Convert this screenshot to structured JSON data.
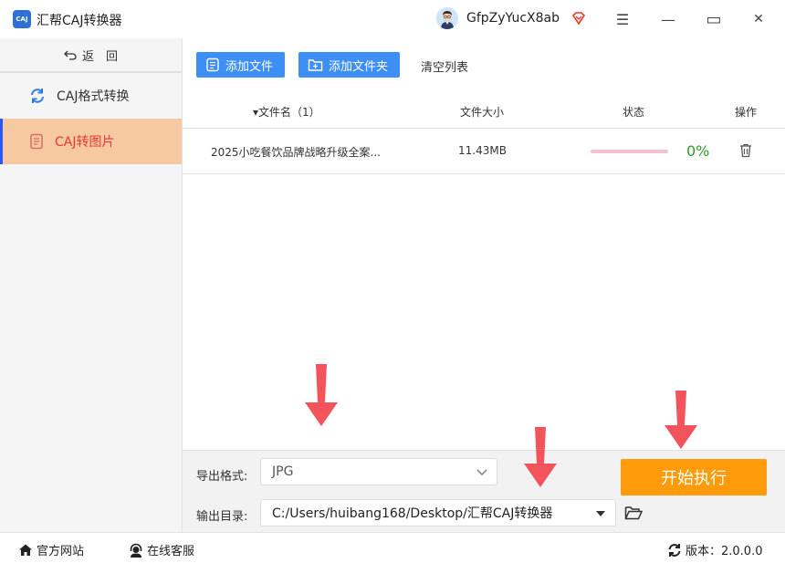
{
  "titlebar": {
    "logo_text": "CAJ",
    "app_title": "汇帮CAJ转换器",
    "user_name": "GfpZyYucX8ab",
    "menu_glyph": "☰",
    "minimize_glyph": "—",
    "maximize_glyph": "▭",
    "close_glyph": "✕"
  },
  "sidebar": {
    "back_label": "返　回",
    "items": [
      {
        "label": "CAJ格式转换",
        "icon": "refresh-icon"
      },
      {
        "label": "CAJ转图片",
        "icon": "document-icon",
        "active": true
      }
    ]
  },
  "toolbar": {
    "add_file_label": "添加文件",
    "add_folder_label": "添加文件夹",
    "clear_list_label": "清空列表"
  },
  "table": {
    "headers": {
      "filename": "▾文件名（1）",
      "filesize": "文件大小",
      "status": "状态",
      "actions": "操作"
    },
    "rows": [
      {
        "filename": "2025小吃餐饮品牌战略升级全案...",
        "filesize": "11.43MB",
        "progress": 0,
        "progress_text": "0%"
      }
    ]
  },
  "settings": {
    "format_label": "导出格式:",
    "format_value": "JPG",
    "output_label": "输出目录:",
    "output_value": "C:/Users/huibang168/Desktop/汇帮CAJ转换器",
    "start_label": "开始执行"
  },
  "statusbar": {
    "website_label": "官方网站",
    "support_label": "在线客服",
    "version_label": "版本：2.0.0.0"
  },
  "colors": {
    "accent_blue": "#3d8ef5",
    "start_orange": "#ff9a0a",
    "active_bg": "#f6c9a3",
    "active_text": "#e8392f",
    "arrow_red": "#f2545b",
    "progress_green": "#2b9a2b"
  }
}
